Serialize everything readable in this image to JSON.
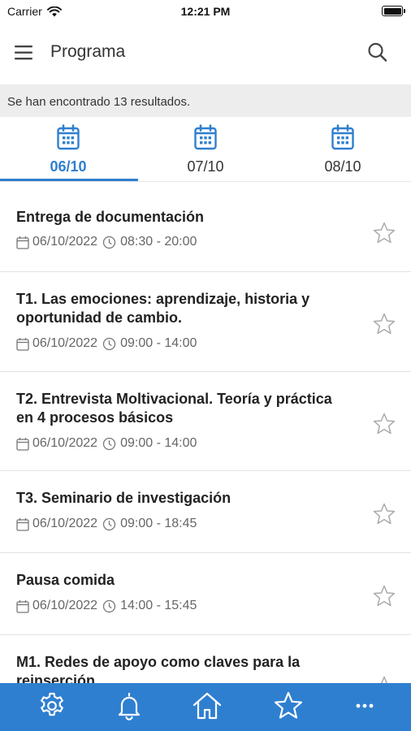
{
  "status_bar": {
    "carrier": "Carrier",
    "time": "12:21 PM",
    "battery_level": 1.0
  },
  "header": {
    "title": "Programa",
    "menu_icon": "menu-icon",
    "search_icon": "search-icon"
  },
  "results": {
    "text": "Se han encontrado 13 resultados."
  },
  "tabs": [
    {
      "label": "06/10",
      "active": true,
      "icon": "calendar-icon"
    },
    {
      "label": "07/10",
      "active": false,
      "icon": "calendar-icon"
    },
    {
      "label": "08/10",
      "active": false,
      "icon": "calendar-icon"
    }
  ],
  "events": [
    {
      "title": "Entrega de documentación",
      "date": "06/10/2022",
      "time": "08:30 - 20:00"
    },
    {
      "title": "T1. Las emociones: aprendizaje, historia y oportunidad de cambio.",
      "date": "06/10/2022",
      "time": "09:00 - 14:00"
    },
    {
      "title": "T2. Entrevista Moltivacional. Teoría y práctica en 4 procesos básicos",
      "date": "06/10/2022",
      "time": "09:00 - 14:00"
    },
    {
      "title": "T3. Seminario de investigación",
      "date": "06/10/2022",
      "time": "09:00 - 18:45"
    },
    {
      "title": "Pausa comida",
      "date": "06/10/2022",
      "time": "14:00 - 15:45"
    },
    {
      "title": "M1. Redes de apoyo como claves para la reinserción",
      "date": "",
      "time": ""
    }
  ],
  "bottom_nav": [
    {
      "name": "settings",
      "icon": "gear-icon"
    },
    {
      "name": "notifications",
      "icon": "bell-icon"
    },
    {
      "name": "home",
      "icon": "home-icon"
    },
    {
      "name": "favorites",
      "icon": "star-icon"
    },
    {
      "name": "more",
      "icon": "more-icon"
    }
  ],
  "colors": {
    "accent": "#2f7fd0",
    "results_bg": "#ededed",
    "meta_text": "#666666"
  }
}
